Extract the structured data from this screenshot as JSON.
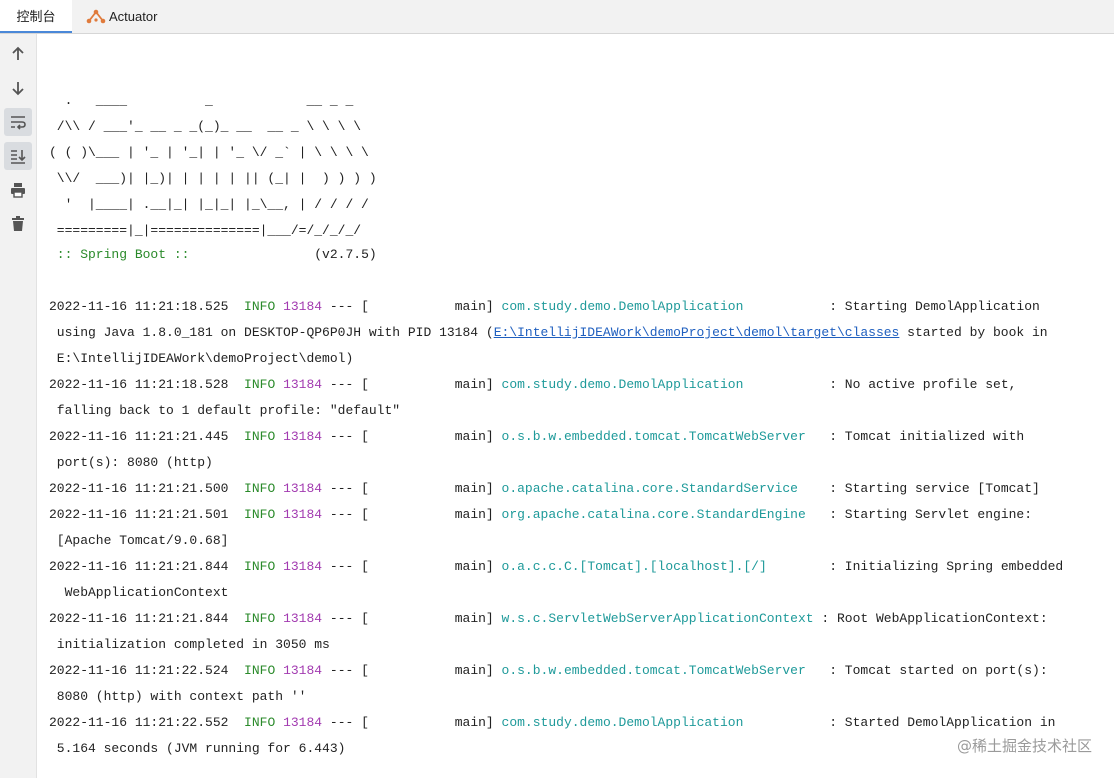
{
  "tabs": {
    "console": "控制台",
    "actuator": "Actuator"
  },
  "toolbar": {
    "buttons": [
      "arrow-up-icon",
      "arrow-down-icon",
      "soft-wrap-icon",
      "scroll-to-end-icon",
      "print-icon",
      "trash-icon"
    ]
  },
  "banner": {
    "l1": "  .   ____          _            __ _ _",
    "l2": " /\\\\ / ___'_ __ _ _(_)_ __  __ _ \\ \\ \\ \\",
    "l3": "( ( )\\___ | '_ | '_| | '_ \\/ _` | \\ \\ \\ \\",
    "l4": " \\\\/  ___)| |_)| | | | | || (_| |  ) ) ) )",
    "l5": "  '  |____| .__|_| |_|_| |_\\__, | / / / /",
    "l6": " =========|_|==============|___/=/_/_/_/",
    "spring": " :: Spring Boot ::",
    "version": "                (v2.7.5)"
  },
  "logs": [
    {
      "time": "2022-11-16 11:21:18.525",
      "level": "INFO",
      "pid": "13184",
      "thread": " --- [           main] ",
      "logger": "com.study.demo.DemolApplication          ",
      "msg": " : Starting DemolApplication",
      "cont": [
        " using Java 1.8.0_181 on DESKTOP-QP6P0JH with PID 13184 (",
        " E:\\IntellijIDEAWork\\demoProject\\demol)"
      ],
      "link": "E:\\IntellijIDEAWork\\demoProject\\demol\\target\\classes",
      "after_link": " started by book in"
    },
    {
      "time": "2022-11-16 11:21:18.528",
      "level": "INFO",
      "pid": "13184",
      "thread": " --- [           main] ",
      "logger": "com.study.demo.DemolApplication          ",
      "msg": " : No active profile set,",
      "cont": [
        " falling back to 1 default profile: \"default\""
      ]
    },
    {
      "time": "2022-11-16 11:21:21.445",
      "level": "INFO",
      "pid": "13184",
      "thread": " --- [           main] ",
      "logger": "o.s.b.w.embedded.tomcat.TomcatWebServer  ",
      "msg": " : Tomcat initialized with",
      "cont": [
        " port(s): 8080 (http)"
      ]
    },
    {
      "time": "2022-11-16 11:21:21.500",
      "level": "INFO",
      "pid": "13184",
      "thread": " --- [           main] ",
      "logger": "o.apache.catalina.core.StandardService   ",
      "msg": " : Starting service [Tomcat]",
      "cont": []
    },
    {
      "time": "2022-11-16 11:21:21.501",
      "level": "INFO",
      "pid": "13184",
      "thread": " --- [           main] ",
      "logger": "org.apache.catalina.core.StandardEngine  ",
      "msg": " : Starting Servlet engine:",
      "cont": [
        " [Apache Tomcat/9.0.68]"
      ]
    },
    {
      "time": "2022-11-16 11:21:21.844",
      "level": "INFO",
      "pid": "13184",
      "thread": " --- [           main] ",
      "logger": "o.a.c.c.C.[Tomcat].[localhost].[/]       ",
      "msg": " : Initializing Spring embedded",
      "cont": [
        "  WebApplicationContext"
      ]
    },
    {
      "time": "2022-11-16 11:21:21.844",
      "level": "INFO",
      "pid": "13184",
      "thread": " --- [           main] ",
      "logger": "w.s.c.ServletWebServerApplicationContext",
      "msg": " : Root WebApplicationContext:",
      "cont": [
        " initialization completed in 3050 ms"
      ]
    },
    {
      "time": "2022-11-16 11:21:22.524",
      "level": "INFO",
      "pid": "13184",
      "thread": " --- [           main] ",
      "logger": "o.s.b.w.embedded.tomcat.TomcatWebServer  ",
      "msg": " : Tomcat started on port(s):",
      "cont": [
        " 8080 (http) with context path ''"
      ]
    },
    {
      "time": "2022-11-16 11:21:22.552",
      "level": "INFO",
      "pid": "13184",
      "thread": " --- [           main] ",
      "logger": "com.study.demo.DemolApplication          ",
      "msg": " : Started DemolApplication in",
      "cont": [
        " 5.164 seconds (JVM running for 6.443)"
      ]
    }
  ],
  "watermark": "@稀土掘金技术社区"
}
